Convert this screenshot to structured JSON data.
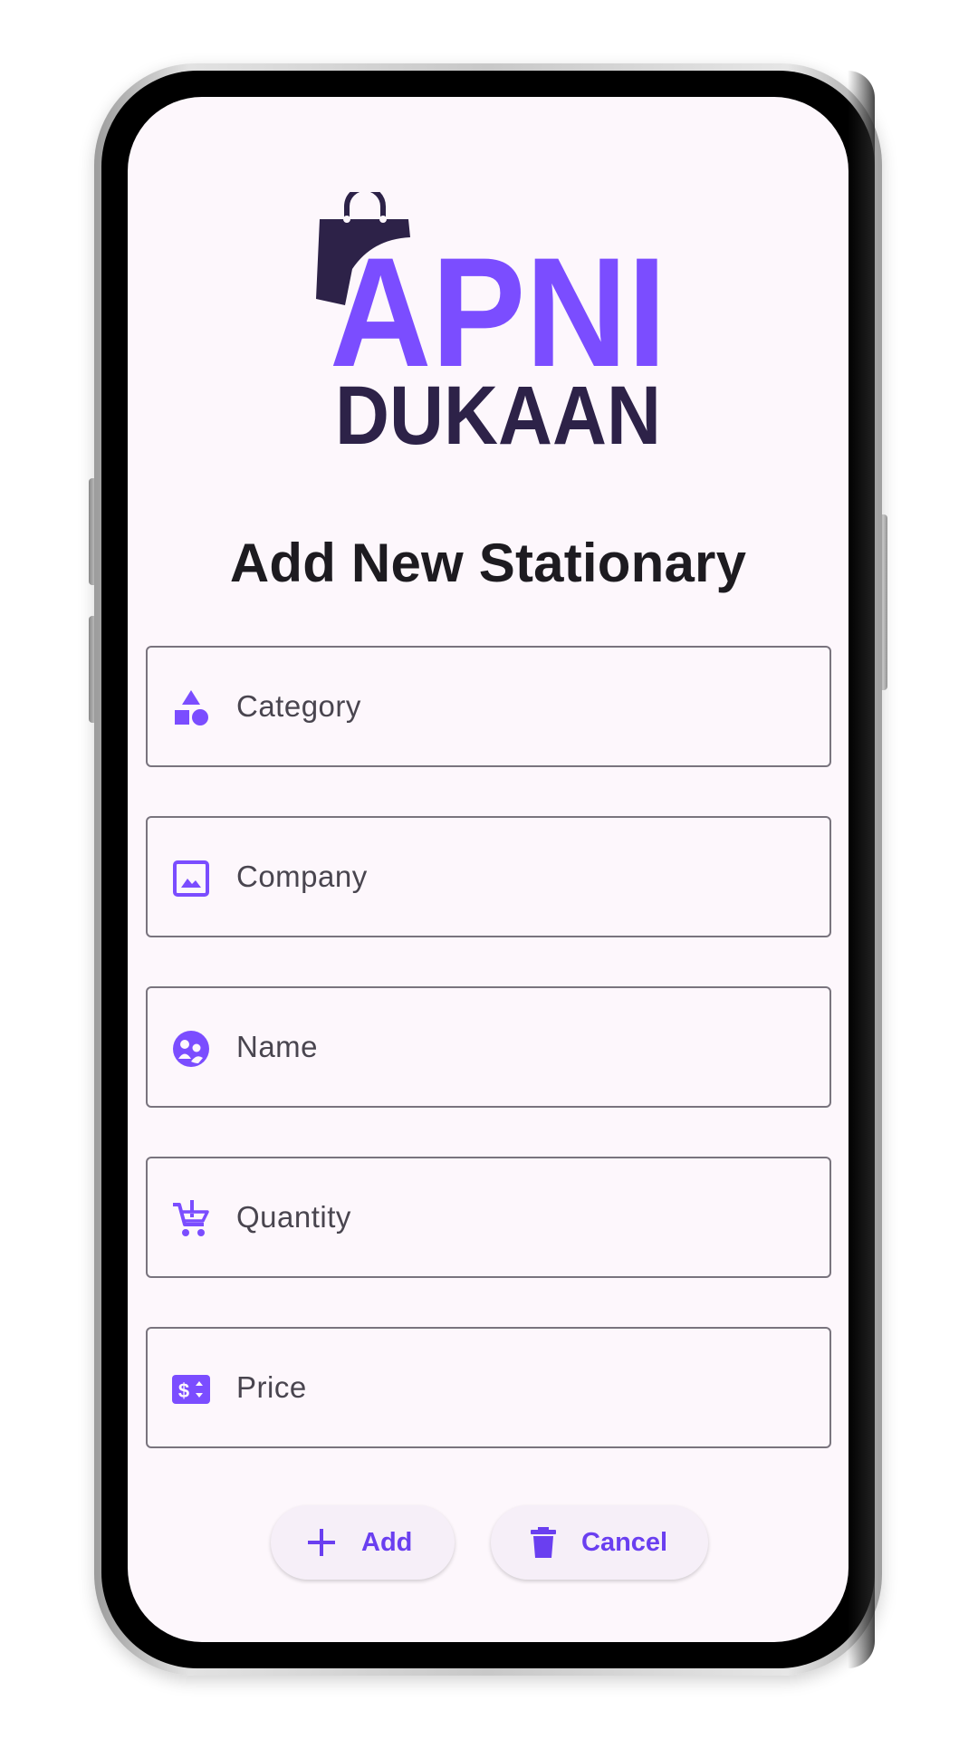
{
  "logo": {
    "line1": "APNI",
    "line2": "DUKAAN",
    "icon": "shopping-bag-icon",
    "colors": {
      "primary": "#7b4dff",
      "dark": "#2d2248"
    }
  },
  "page": {
    "title": "Add New Stationary"
  },
  "fields": [
    {
      "label": "Category",
      "icon": "category-shapes-icon"
    },
    {
      "label": "Company",
      "icon": "image-icon"
    },
    {
      "label": "Name",
      "icon": "face-icon"
    },
    {
      "label": "Quantity",
      "icon": "cart-alert-icon"
    },
    {
      "label": "Price",
      "icon": "price-tag-icon"
    }
  ],
  "buttons": {
    "add": {
      "label": "Add",
      "icon": "plus-icon"
    },
    "cancel": {
      "label": "Cancel",
      "icon": "trash-icon"
    }
  },
  "theme": {
    "accent": "#7b4dff",
    "button_text": "#6a3ff0",
    "screen_bg": "#fdf7fc",
    "border": "#79747e",
    "label_text": "#49454f",
    "title_text": "#1d1b20"
  }
}
